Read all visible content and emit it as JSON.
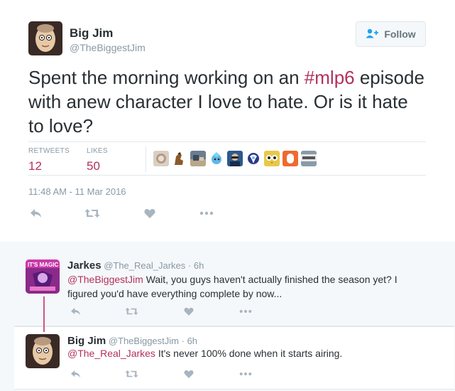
{
  "tweet": {
    "author_name": "Big Jim",
    "author_handle": "@TheBiggestJim",
    "follow_label": "Follow",
    "text_before": "Spent the morning working on an ",
    "hashtag": "#mlp6",
    "text_after": " episode with anew character I love to hate. Or is it hate to love?",
    "retweets_label": "RETWEETS",
    "retweets_count": "12",
    "likes_label": "LIKES",
    "likes_count": "50",
    "timestamp": "11:48 AM - 11 Mar 2016",
    "liker_avatars": [
      "liker-avatar-1",
      "liker-avatar-2",
      "liker-avatar-3",
      "liker-avatar-4",
      "liker-avatar-5",
      "liker-avatar-6",
      "liker-avatar-7",
      "liker-avatar-8",
      "liker-avatar-9"
    ]
  },
  "replies": [
    {
      "name": "Jarkes",
      "handle": "@The_Real_Jarkes",
      "time": "6h",
      "mention": "@TheBiggestJim",
      "text": " Wait, you guys haven't actually finished the season yet? I figured you'd have everything complete by now...",
      "avatar_text": "IT'S MAGIC"
    },
    {
      "name": "Big Jim",
      "handle": "@TheBiggestJim",
      "time": "6h",
      "mention": "@The_Real_Jarkes",
      "text": " It's never 100% done when it starts airing."
    }
  ],
  "colors": {
    "accent": "#b3315c",
    "muted": "#8899a6",
    "text": "#292f33",
    "thread_line": "#c9578a",
    "reply_bg": "#f5f8fa"
  },
  "icons": [
    "reply-icon",
    "retweet-icon",
    "like-icon",
    "more-icon",
    "follow-person-icon"
  ]
}
